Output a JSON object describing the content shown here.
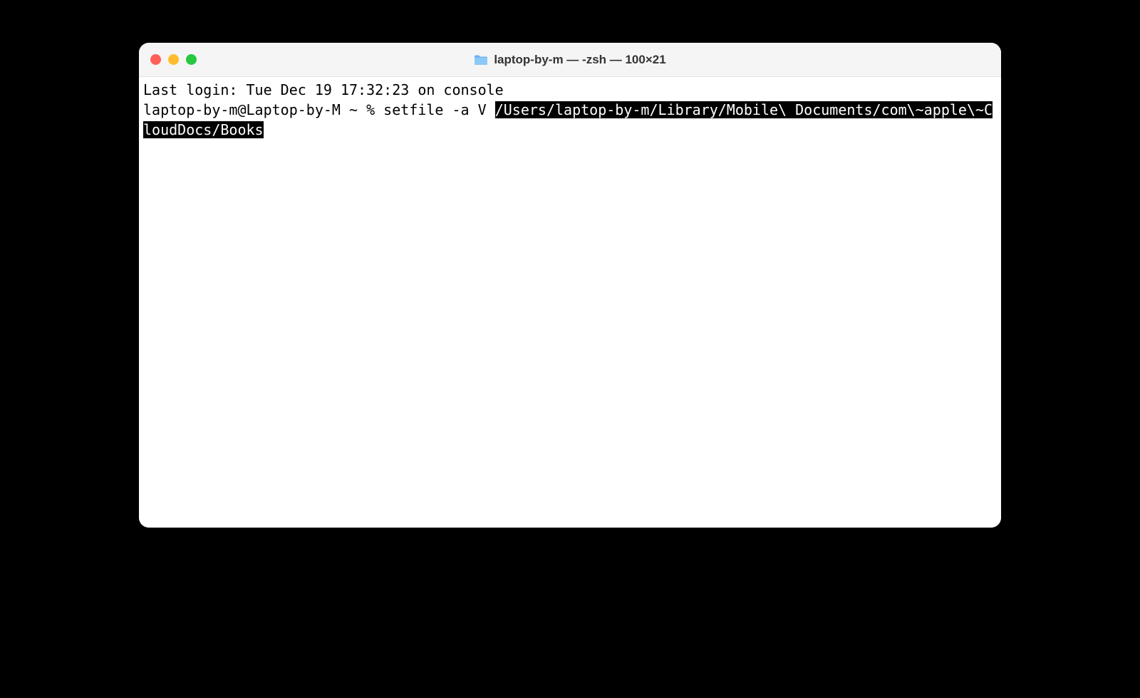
{
  "window": {
    "title": "laptop-by-m — -zsh — 100×21",
    "traffic_lights": {
      "close": "#ff5f57",
      "minimize": "#febc2e",
      "maximize": "#28c840"
    },
    "folder_icon": "folder-icon"
  },
  "terminal": {
    "last_login": "Last login: Tue Dec 19 17:32:23 on console",
    "prompt": "laptop-by-m@Laptop-by-M ~ % ",
    "command_plain": "setfile -a V ",
    "command_highlighted": "/Users/laptop-by-m/Library/Mobile\\ Documents/com\\~apple\\~CloudDocs/Books "
  }
}
